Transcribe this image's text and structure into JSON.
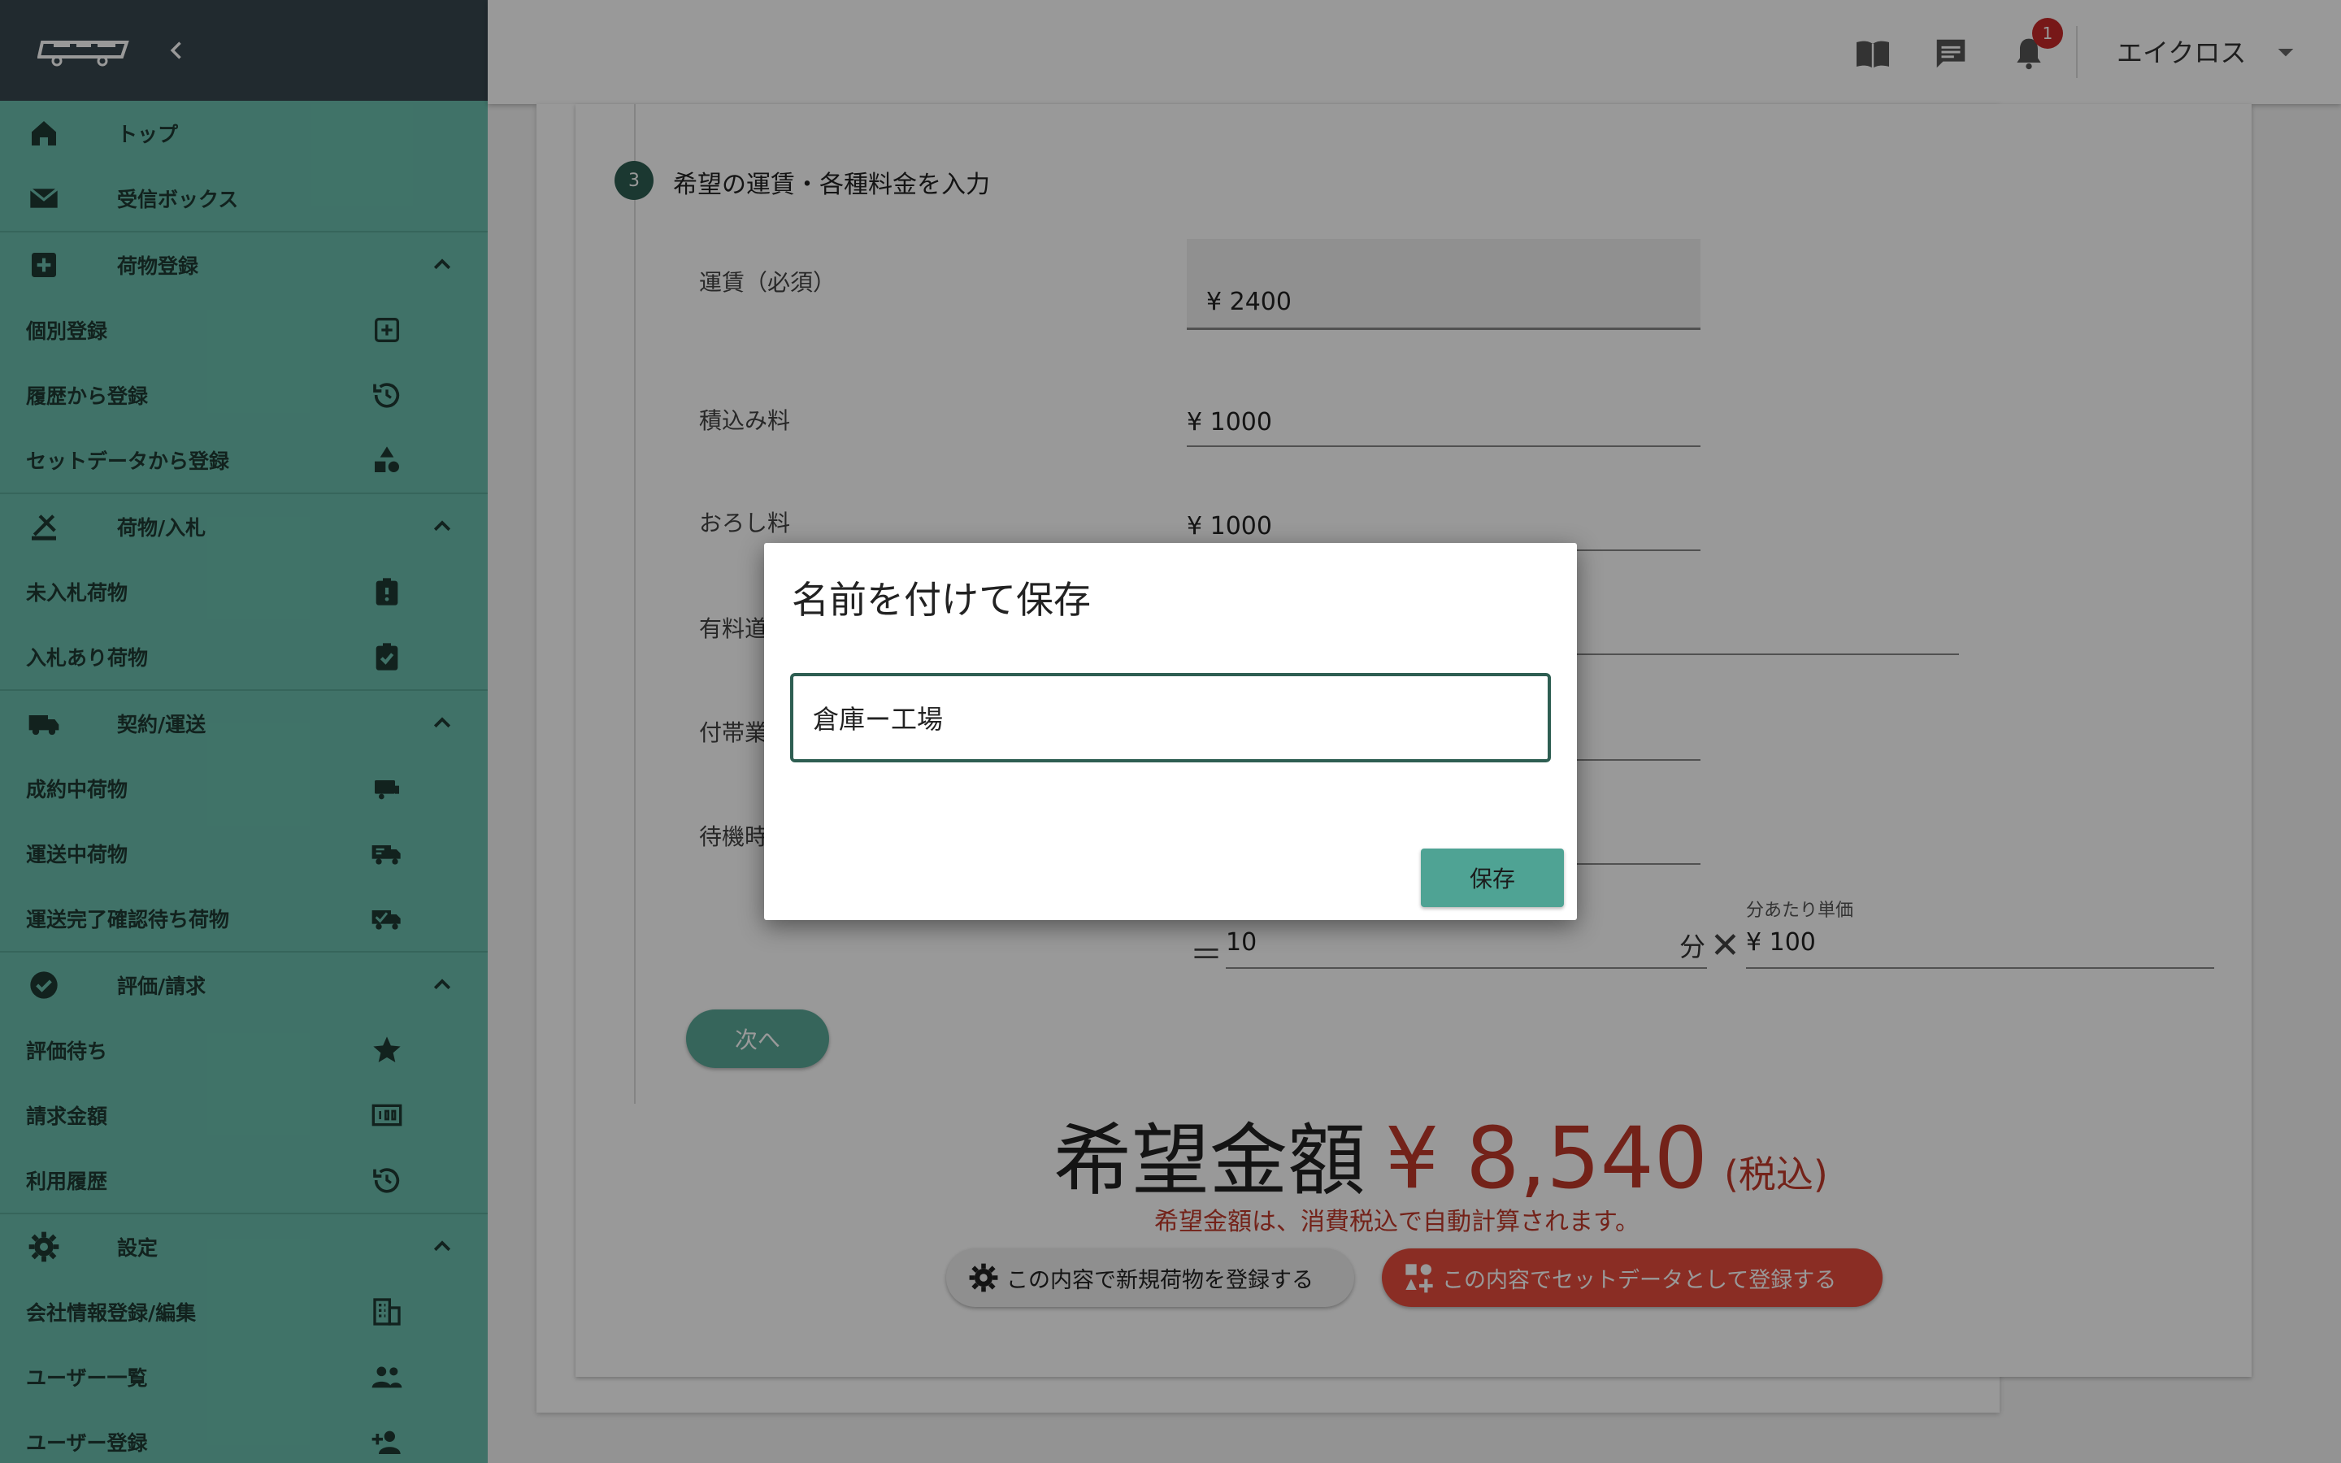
{
  "colors": {
    "sidebar_bg": "#6bbfae",
    "sidebar_header_bg": "#37474f",
    "accent": "#2e5e52",
    "button_teal": "#4fa394",
    "price_red": "#c0392b",
    "set_button_red": "#e74c3c",
    "badge_red": "#c62828"
  },
  "sidebar": {
    "logo": "logo-mark",
    "collapse_icon": "chevron-left-icon",
    "items": [
      {
        "label": "トップ",
        "icon": "home-icon",
        "type": "top"
      },
      {
        "label": "受信ボックス",
        "icon": "mail-icon",
        "type": "top"
      },
      {
        "label": "荷物登録",
        "icon": "add-box-icon",
        "type": "section"
      },
      {
        "label": "個別登録",
        "icon": "add-square-icon",
        "type": "sub"
      },
      {
        "label": "履歴から登録",
        "icon": "history-icon",
        "type": "sub"
      },
      {
        "label": "セットデータから登録",
        "icon": "shapes-icon",
        "type": "sub"
      },
      {
        "label": "荷物/入札",
        "icon": "gavel-icon",
        "type": "section"
      },
      {
        "label": "未入札荷物",
        "icon": "clipboard-alert-icon",
        "type": "sub"
      },
      {
        "label": "入札あり荷物",
        "icon": "clipboard-check-icon",
        "type": "sub"
      },
      {
        "label": "契約/運送",
        "icon": "truck-icon",
        "type": "section"
      },
      {
        "label": "成約中荷物",
        "icon": "truck-small-icon",
        "type": "sub"
      },
      {
        "label": "運送中荷物",
        "icon": "truck-moving-icon",
        "type": "sub"
      },
      {
        "label": "運送完了確認待ち荷物",
        "icon": "truck-check-icon",
        "type": "sub"
      },
      {
        "label": "評価/請求",
        "icon": "check-circle-icon",
        "type": "section"
      },
      {
        "label": "評価待ち",
        "icon": "star-icon",
        "type": "sub"
      },
      {
        "label": "請求金額",
        "icon": "money-icon",
        "type": "sub"
      },
      {
        "label": "利用履歴",
        "icon": "history-icon",
        "type": "sub"
      },
      {
        "label": "設定",
        "icon": "gear-icon",
        "type": "section"
      },
      {
        "label": "会社情報登録/編集",
        "icon": "building-icon",
        "type": "sub"
      },
      {
        "label": "ユーザー一覧",
        "icon": "people-icon",
        "type": "sub"
      },
      {
        "label": "ユーザー登録",
        "icon": "person-add-icon",
        "type": "sub"
      }
    ]
  },
  "topbar": {
    "manual_icon": "book-open-icon",
    "chat_icon": "chat-icon",
    "bell_icon": "bell-icon",
    "notification_count": "1",
    "user_name": "エイクロス",
    "user_menu_icon": "caret-down-icon"
  },
  "step": {
    "number": "3",
    "title": "希望の運賃・各種料金を入力"
  },
  "fields": {
    "fare_label": "運賃（必須）",
    "fare_value": "¥ 2400",
    "loading_label": "積込み料",
    "loading_value": "¥ 1000",
    "unloading_label": "おろし料",
    "unloading_value": "¥ 1000",
    "toll_label_partial": "有料道",
    "ancillary_label_partial": "付帯業",
    "waiting_label_partial": "待機時",
    "unit_price_label": "分あたり単価",
    "minutes_value": "10",
    "minutes_unit": "分",
    "unit_price_value": "¥ 100",
    "equals": "＝",
    "times": "✕"
  },
  "next_button": "次へ",
  "total": {
    "label": "希望金額",
    "amount": "¥ 8,540",
    "tax": "(税込)",
    "note": "希望金額は、消費税込で自動計算されます。"
  },
  "buttons": {
    "register_new": "この内容で新規荷物を登録する",
    "register_set": "この内容でセットデータとして登録する"
  },
  "dialog": {
    "title": "名前を付けて保存",
    "input_value": "倉庫ー工場",
    "save_label": "保存"
  }
}
